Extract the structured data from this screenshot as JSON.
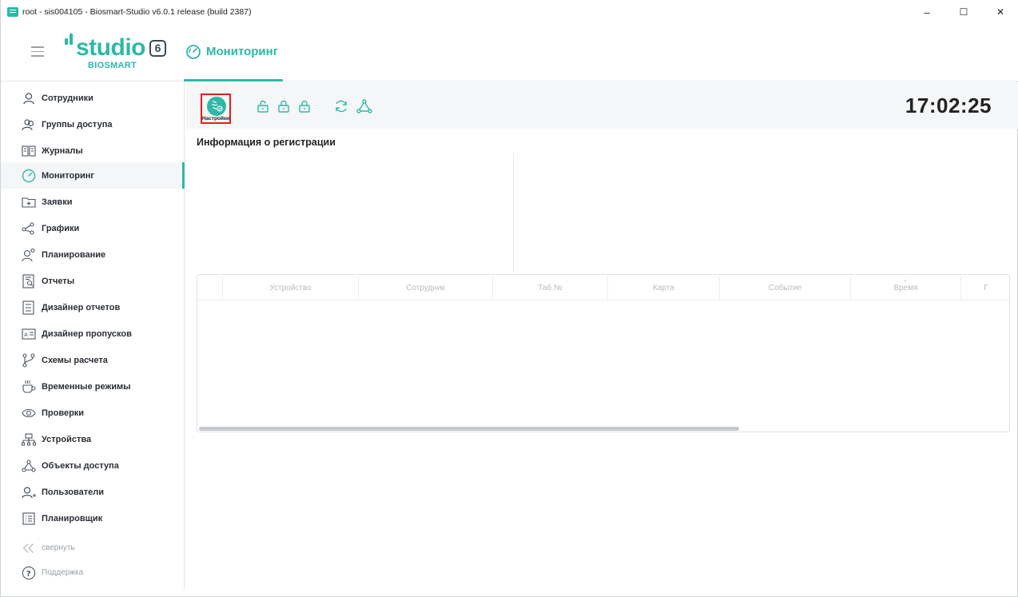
{
  "window": {
    "title": "root - sis004105 - Biosmart-Studio v6.0.1 release (build 2387)",
    "controls": {
      "minimize": "–",
      "maximize": "☐",
      "close": "✕"
    }
  },
  "header": {
    "logo_word": "studio",
    "logo_number": "6",
    "logo_sub": "BIOSMART",
    "page_tab": "Мониторинг",
    "accent_color": "#2eb8a8"
  },
  "sidebar": {
    "items": [
      {
        "label": "Сотрудники",
        "icon": "person-icon"
      },
      {
        "label": "Группы доступа",
        "icon": "group-icon"
      },
      {
        "label": "Журналы",
        "icon": "journal-icon"
      },
      {
        "label": "Мониторинг",
        "icon": "gauge-icon",
        "active": true
      },
      {
        "label": "Заявки",
        "icon": "folder-plus-icon"
      },
      {
        "label": "Графики",
        "icon": "share-nodes-icon"
      },
      {
        "label": "Планирование",
        "icon": "planning-icon"
      },
      {
        "label": "Отчеты",
        "icon": "report-icon"
      },
      {
        "label": "Дизайнер отчетов",
        "icon": "report-designer-icon"
      },
      {
        "label": "Дизайнер пропусков",
        "icon": "badge-designer-icon"
      },
      {
        "label": "Схемы расчета",
        "icon": "branch-icon"
      },
      {
        "label": "Временные режимы",
        "icon": "cup-icon"
      },
      {
        "label": "Проверки",
        "icon": "eye-icon"
      },
      {
        "label": "Устройства",
        "icon": "network-icon"
      },
      {
        "label": "Объекты доступа",
        "icon": "nodes-icon"
      },
      {
        "label": "Пользователи",
        "icon": "user-add-icon"
      },
      {
        "label": "Планировщик",
        "icon": "scheduler-icon"
      }
    ],
    "collapse_label": "свернуть",
    "support_label": "Поддержка"
  },
  "toolbar": {
    "settings_caption": "Настройки",
    "clock": "17:02:25"
  },
  "main": {
    "section_title": "Информация о регистрации",
    "columns": [
      "",
      "Устройство",
      "Сотрудник",
      "Таб.№",
      "Карта",
      "Событие",
      "Время",
      "Г"
    ]
  }
}
